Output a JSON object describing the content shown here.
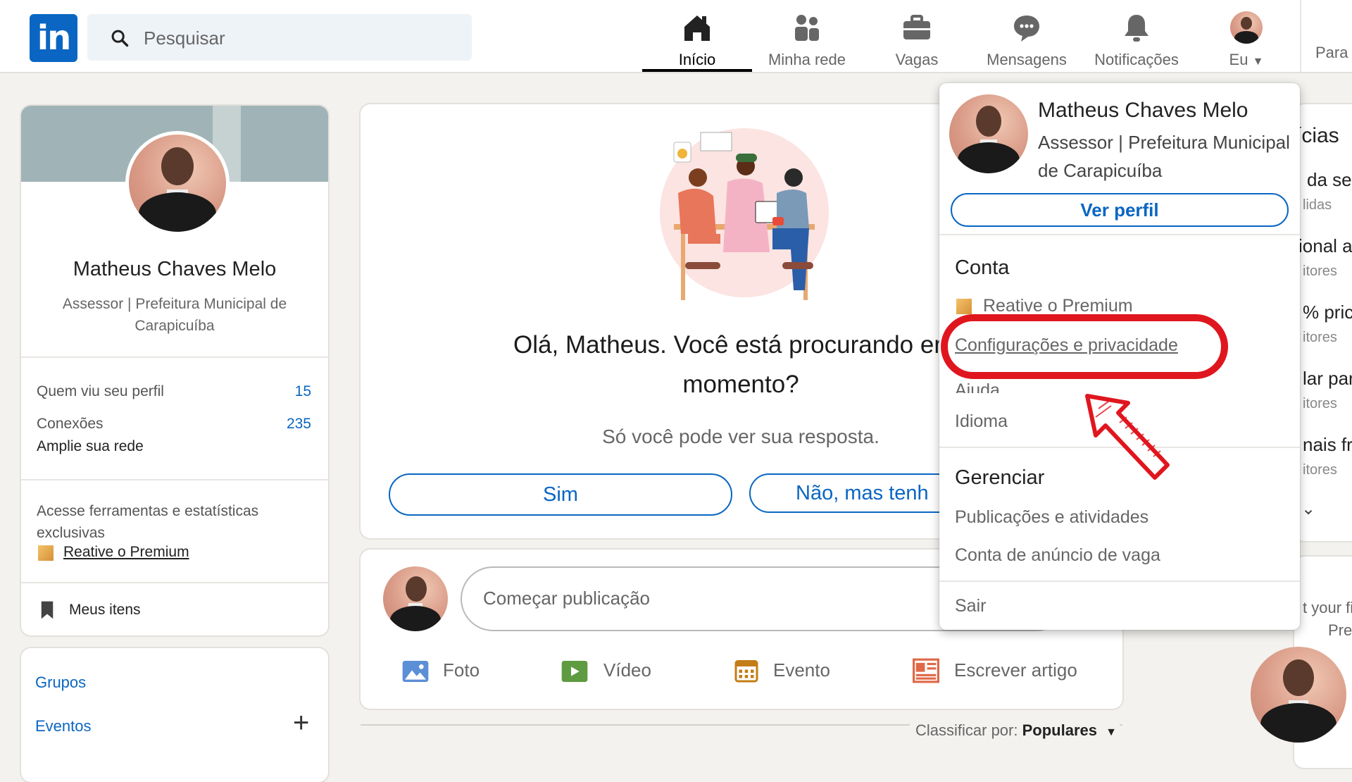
{
  "nav": {
    "search_placeholder": "Pesquisar",
    "items": [
      {
        "label": "Início",
        "icon": "home-icon",
        "active": true
      },
      {
        "label": "Minha rede",
        "icon": "network-icon"
      },
      {
        "label": "Vagas",
        "icon": "briefcase-icon"
      },
      {
        "label": "Mensagens",
        "icon": "message-icon"
      },
      {
        "label": "Notificações",
        "icon": "bell-icon"
      },
      {
        "label": "Eu",
        "icon": "avatar"
      }
    ],
    "for_business": "Para"
  },
  "profile": {
    "name": "Matheus Chaves Melo",
    "headline": "Assessor | Prefeitura Municipal de Carapicuíba",
    "who_viewed_label": "Quem viu seu perfil",
    "who_viewed_value": "15",
    "connections_label": "Conexões",
    "connections_value": "235",
    "grow_network": "Amplie sua rede",
    "premium_text": "Acesse ferramentas e estatísticas exclusivas",
    "premium_link": "Reative o Premium",
    "my_items": "Meus itens"
  },
  "sidebar_links": {
    "groups": "Grupos",
    "events": "Eventos"
  },
  "job_prompt": {
    "question_line1": "Olá, Matheus. Você está procurando emp",
    "question_line2": "momento?",
    "subtitle": "Só você pode ver sua resposta.",
    "yes": "Sim",
    "no": "Não, mas tenh"
  },
  "share_box": {
    "placeholder": "Começar publicação",
    "actions": [
      "Foto",
      "Vídeo",
      "Evento",
      "Escrever artigo"
    ]
  },
  "sort": {
    "label": "Classificar por:",
    "value": "Populares"
  },
  "right_rail": {
    "lines": [
      "ícias",
      "da se",
      "lidas",
      "ional a",
      "itores",
      "% pric",
      "itores",
      "lar par",
      "itores",
      "nais fr",
      "itores"
    ],
    "ad_lines": [
      "t your fi",
      "Pre"
    ]
  },
  "dropdown": {
    "name": "Matheus Chaves Melo",
    "title": "Assessor | Prefeitura Municipal de Carapicuíba",
    "view_profile": "Ver perfil",
    "account_header": "Conta",
    "premium": "Reative o Premium",
    "settings": "Configurações e privacidade",
    "help": "Ajuda",
    "language": "Idioma",
    "manage_header": "Gerenciar",
    "posts": "Publicações e atividades",
    "job_ads": "Conta de anúncio de vaga",
    "signout": "Sair"
  },
  "colors": {
    "brand": "#0a66c2",
    "annotation": "#e0161e",
    "background": "#f3f2ef"
  }
}
